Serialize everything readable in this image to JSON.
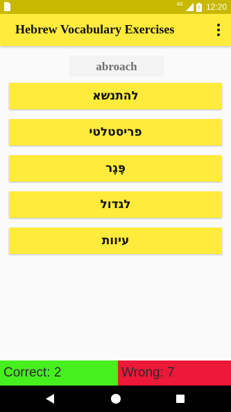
{
  "status_bar": {
    "network": "4G",
    "time": "12:20",
    "icons": [
      "sim-card-icon",
      "signal-icon",
      "battery-icon"
    ]
  },
  "app_bar": {
    "title": "Hebrew Vocabulary Exercises",
    "menu_icon": "more-vert-icon"
  },
  "exercise": {
    "word": "abroach",
    "answers": [
      "להתנשא",
      "פריסטלטי",
      "פֶּגֶר",
      "לגדול",
      "עיוות"
    ]
  },
  "score": {
    "correct_label": "Correct: 2",
    "wrong_label": "Wrong: 7"
  },
  "colors": {
    "accent": "#ffeb3b",
    "status_bar": "#c9b800",
    "correct": "#46f01e",
    "wrong": "#ee1838"
  }
}
